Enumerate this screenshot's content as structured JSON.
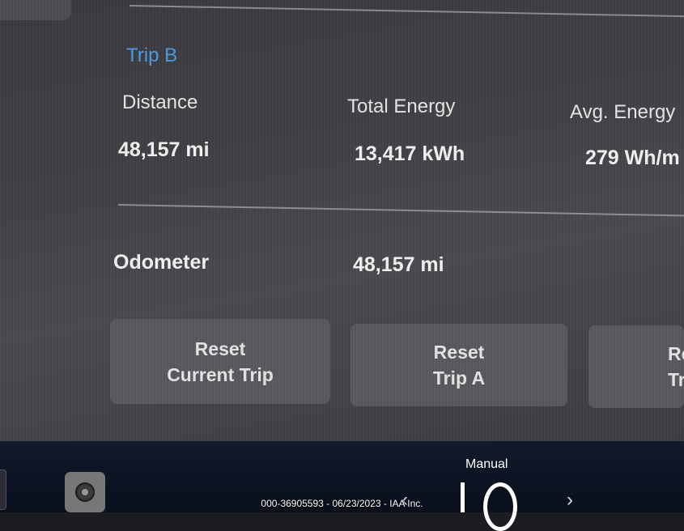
{
  "trip": {
    "title": "Trip B",
    "distance_label": "Distance",
    "distance_value": "48,157 mi",
    "energy_label": "Total Energy",
    "energy_value": "13,417 kWh",
    "avg_label": "Avg. Energy",
    "avg_value": "279 Wh/m"
  },
  "odometer": {
    "label": "Odometer",
    "value": "48,157 mi"
  },
  "buttons": {
    "reset_current_line1": "Reset",
    "reset_current_line2": "Current Trip",
    "reset_a_line1": "Reset",
    "reset_a_line2": "Trip A",
    "reset_b_line1": "Re",
    "reset_b_line2": "Tr"
  },
  "bottom_bar": {
    "gear_label": "Manual",
    "prev_icon": "chevron-left-icon",
    "next_icon": "chevron-right-icon",
    "prev_glyph": "‹",
    "next_glyph": "›"
  },
  "watermark": "000-36905593 - 06/23/2023 - IAA Inc.",
  "colors": {
    "accent": "#4a9be6",
    "screen_bg": "#414145",
    "button_bg": "#58585d",
    "bottom_bar": "#0c1322"
  }
}
